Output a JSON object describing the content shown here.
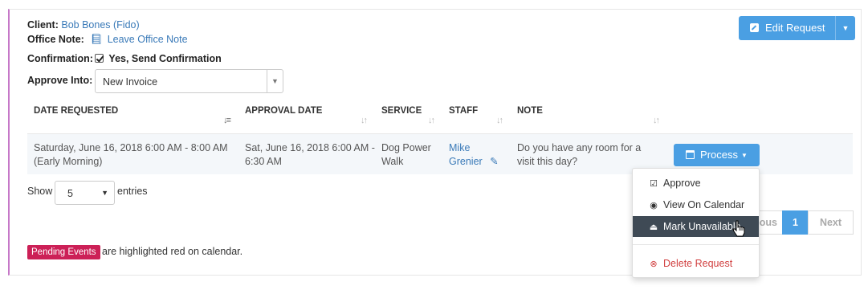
{
  "client": {
    "label": "Client:",
    "value": "Bob Bones (Fido)"
  },
  "office_note": {
    "label": "Office Note:",
    "link": "Leave Office Note"
  },
  "confirmation": {
    "label": "Confirmation:",
    "checked": true,
    "value": "Yes, Send Confirmation"
  },
  "approve_into": {
    "label": "Approve Into:",
    "selected": "New Invoice"
  },
  "edit_request": {
    "label": "Edit Request"
  },
  "table": {
    "headers": [
      "DATE REQUESTED",
      "APPROVAL DATE",
      "SERVICE",
      "STAFF",
      "NOTE"
    ],
    "row": {
      "date_requested_1": "Saturday, June 16, 2018 6:00 AM - 8:00 AM",
      "date_requested_2": "(Early Morning)",
      "approval_1": "Sat, June 16, 2018 6:00 AM -",
      "approval_2": "6:30 AM",
      "service_1": "Dog Power",
      "service_2": "Walk",
      "staff_1": "Mike",
      "staff_2": "Grenier",
      "note_1": "Do you have any room for a",
      "note_2": "visit this day?"
    },
    "process_label": "Process"
  },
  "length": {
    "show": "Show",
    "value": "5",
    "entries": "entries"
  },
  "pagination": {
    "previous_partial": "ous",
    "page": "1",
    "next": "Next"
  },
  "dropdown": {
    "approve": "Approve",
    "view_calendar": "View On Calendar",
    "mark_unavailable": "Mark Unavailable",
    "delete": "Delete Request"
  },
  "legend": {
    "badge": "Pending Events",
    "text": "are highlighted red on calendar."
  },
  "colors": {
    "primary": "#4a9fe3",
    "accent": "#c678c8",
    "badge": "#cc2057",
    "danger": "#d14040"
  }
}
